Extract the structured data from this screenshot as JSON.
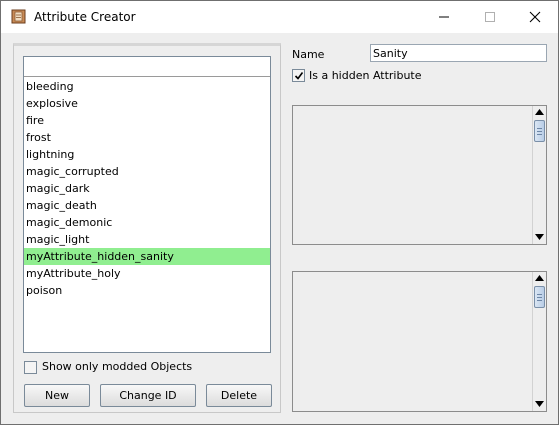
{
  "window": {
    "title": "Attribute Creator",
    "icon": "scroll-document-icon",
    "minimize_icon": "minimize-icon",
    "maximize_icon": "maximize-icon",
    "close_icon": "close-icon"
  },
  "list": {
    "search_value": "",
    "selected_index": 10,
    "items": [
      "bleeding",
      "explosive",
      "fire",
      "frost",
      "lightning",
      "magic_corrupted",
      "magic_dark",
      "magic_death",
      "magic_demonic",
      "magic_light",
      "myAttribute_hidden_sanity",
      "myAttribute_holy",
      "poison"
    ]
  },
  "filter": {
    "label": "Show only modded Objects",
    "checked": false
  },
  "buttons": {
    "new": "New",
    "change_id": "Change ID",
    "delete": "Delete"
  },
  "form": {
    "name_label": "Name",
    "name_value": "Sanity",
    "hidden_label": "Is a hidden Attribute",
    "hidden_checked": true,
    "text_area_1": "",
    "text_area_2": ""
  },
  "colors": {
    "selection": "#90ee90",
    "window_bg": "#eeeeee",
    "scroll_thumb": "#b8cde6"
  }
}
